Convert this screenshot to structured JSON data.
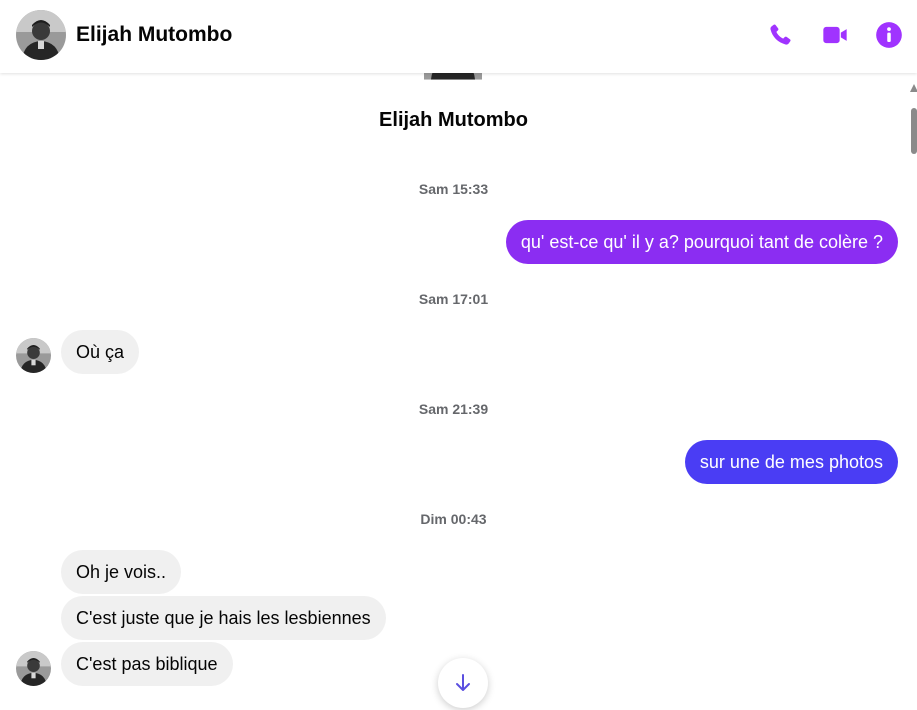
{
  "contact": {
    "name": "Elijah Mutombo"
  },
  "header": {
    "icons": [
      "phone-icon",
      "video-icon",
      "info-icon"
    ],
    "accent": "#a033ff"
  },
  "colors": {
    "outgoing_1": "#8b2df2",
    "outgoing_2": "#4a3df4",
    "incoming": "#f0f0f0",
    "timestamp": "#65676b"
  },
  "messages": {
    "ts1": "Sam 15:33",
    "out1": "qu' est-ce qu' il y a? pourquoi tant de colère ?",
    "ts2": "Sam 17:01",
    "in1": "Où ça",
    "ts3": "Sam 21:39",
    "out2": "sur une de mes photos",
    "ts4": "Dim 00:43",
    "in2": "Oh je vois..",
    "in3": "C'est juste que je hais les lesbiennes",
    "in4": "C'est pas biblique"
  }
}
